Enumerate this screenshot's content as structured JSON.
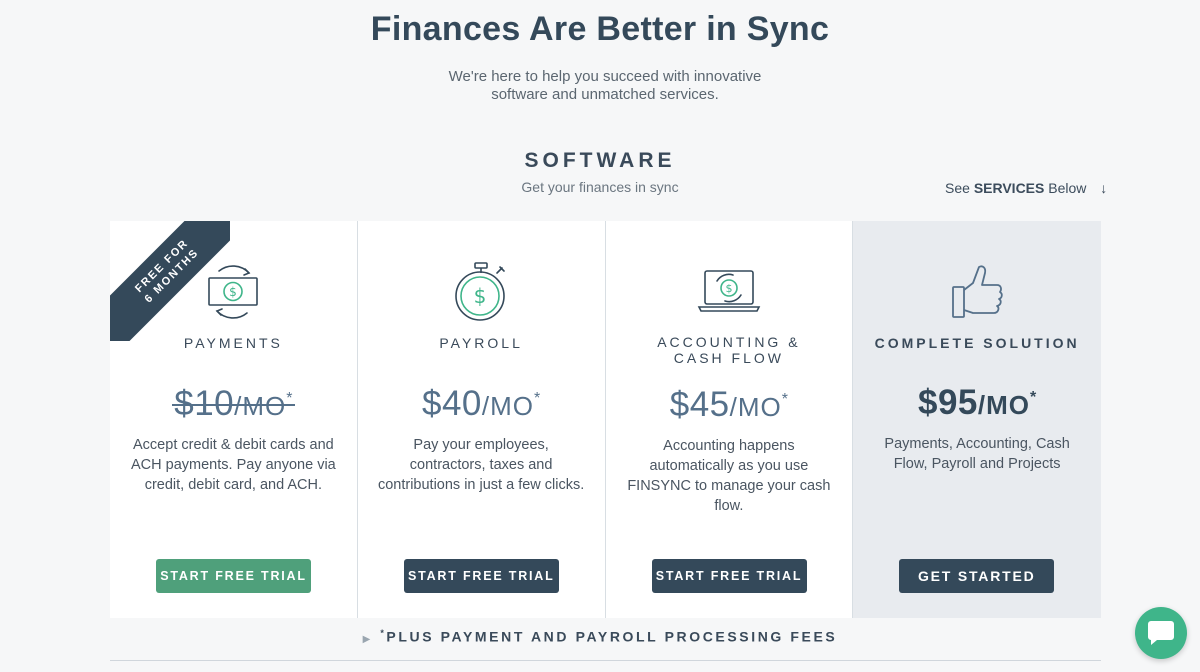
{
  "hero": {
    "title": "Finances Are Better in Sync",
    "subtitle": "We're here to help you succeed with innovative software and unmatched services."
  },
  "section": {
    "title": "SOFTWARE",
    "subtitle": "Get your finances in sync",
    "see_prefix": "See",
    "see_bold": "SERVICES",
    "see_suffix": "Below",
    "see_arrow": "↓"
  },
  "ribbon": {
    "line1": "FREE FOR",
    "line2": "6 MONTHS"
  },
  "cards": [
    {
      "icon": "dollar-cycle-icon",
      "name_line1": "PAYMENTS",
      "name_line2": "",
      "price": "$10",
      "per": "/MO",
      "asterisk": "*",
      "description": "Accept credit & debit cards and ACH payments. Pay anyone via credit, debit card, and ACH.",
      "button": "START FREE TRIAL"
    },
    {
      "icon": "stopwatch-dollar-icon",
      "name_line1": "PAYROLL",
      "name_line2": "",
      "price": "$40",
      "per": "/MO",
      "asterisk": "*",
      "description": "Pay your employees, contractors, taxes and contributions in just a few clicks.",
      "button": "START FREE TRIAL"
    },
    {
      "icon": "laptop-dollar-icon",
      "name_line1": "ACCOUNTING &",
      "name_line2": "CASH FLOW",
      "price": "$45",
      "per": "/MO",
      "asterisk": "*",
      "description": "Accounting happens automatically as you use FINSYNC to manage your cash flow.",
      "button": "START FREE TRIAL"
    },
    {
      "icon": "thumbs-up-icon",
      "name_line1": "COMPLETE SOLUTION",
      "name_line2": "",
      "price": "$95",
      "per": "/MO",
      "asterisk": "*",
      "description": "Payments, Accounting, Cash Flow, Payroll and Projects",
      "button": "GET STARTED"
    }
  ],
  "footnote": {
    "star": "*",
    "text": "PLUS PAYMENT AND PAYROLL PROCESSING FEES"
  },
  "colors": {
    "dark": "#34495a",
    "green": "#4fa07b",
    "chat": "#3fb58a",
    "price": "#55708a"
  }
}
